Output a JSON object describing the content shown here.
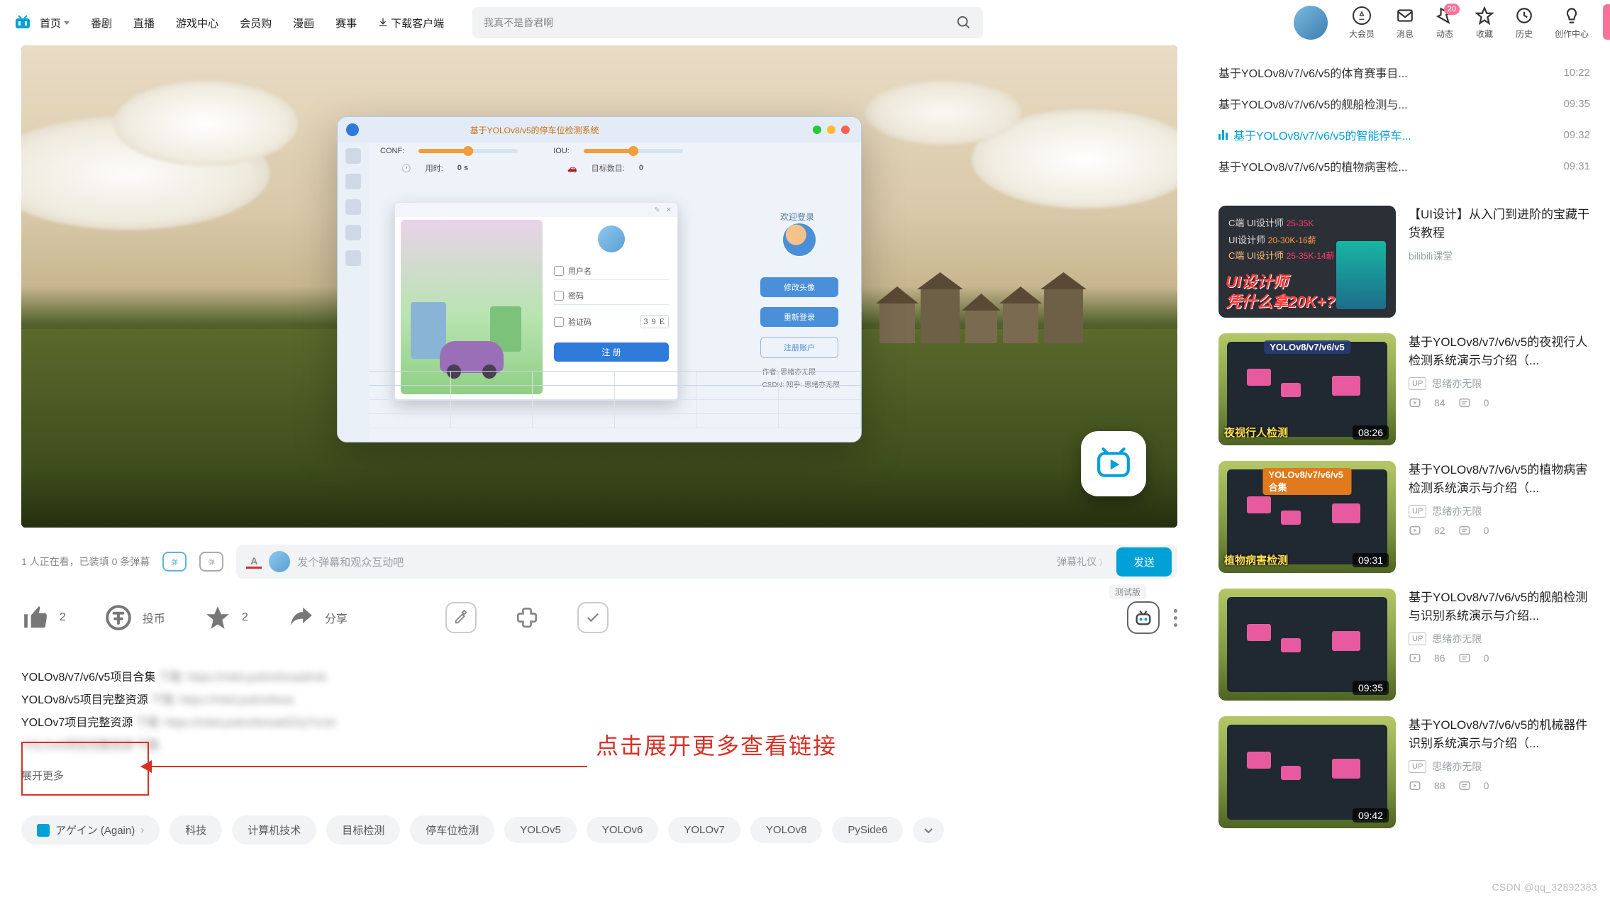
{
  "nav": {
    "items": [
      "首页",
      "番剧",
      "直播",
      "游戏中心",
      "会员购",
      "漫画",
      "赛事"
    ],
    "download": "下载客户端"
  },
  "search": {
    "placeholder": "我真不是昏君啊"
  },
  "usernav": {
    "items": [
      {
        "label": "大会员"
      },
      {
        "label": "消息"
      },
      {
        "label": "动态",
        "badge": "20"
      },
      {
        "label": "收藏"
      },
      {
        "label": "历史"
      },
      {
        "label": "创作中心"
      }
    ]
  },
  "win": {
    "title": "基于YOLOv8/v5的停车位检测系统",
    "conf": "CONF:",
    "iou": "IOU:",
    "timeLbl": "用时:",
    "timeVal": "0 s",
    "tgtLbl": "目标数目:",
    "tgtVal": "0",
    "rtitle": "欢迎登录",
    "captcha": "3 9 E",
    "form": {
      "user": "用户名",
      "pass": "密码",
      "code": "验证码",
      "reg": "注 册"
    },
    "btns": [
      "修改头像",
      "重新登录",
      "注册账户"
    ],
    "info1": "作者: 思绪亦无限",
    "info2": "CSDN: 知乎: 思绪亦无限"
  },
  "dmk": {
    "viewers": "1 人正在看，已装填 0 条弹幕",
    "placeholder": "发个弹幕和观众互动吧",
    "courtesy": "弹幕礼仪",
    "send": "发送"
  },
  "actions": {
    "like": "2",
    "coin": "投币",
    "fav": "2",
    "share": "分享",
    "ai_label": "测试版"
  },
  "desc": {
    "l1_clear": "YOLOv8/v7/v6/v5项目合集",
    "l1_blur": "下载: https://mbd.pub/o/bread/mb",
    "l2_clear": "YOLOv8/v5项目完整资源",
    "l2_blur": "下载: https://mbd.pub/o/brea",
    "l3_clear": "YOLOv7项目完整资源",
    "l3_blur": "下载: https://mbd.pub/o/bread/ZZyTmJe",
    "l4_clear": "YOLOv6项目完整资源",
    "l4_blur": "下载:",
    "expand": "展开更多",
    "anno": "点击展开更多查看链接"
  },
  "tags": [
    "アゲイン (Again)",
    "科技",
    "计算机技术",
    "目标检测",
    "停车位检测",
    "YOLOv5",
    "YOLOv6",
    "YOLOv7",
    "YOLOv8",
    "PySide6"
  ],
  "playlist": [
    {
      "title": "基于YOLOv8/v7/v6/v5的体育赛事目...",
      "time": "10:22",
      "active": false
    },
    {
      "title": "基于YOLOv8/v7/v6/v5的舰船检测与...",
      "time": "09:35",
      "active": false
    },
    {
      "title": "基于YOLOv8/v7/v6/v5的智能停车...",
      "time": "09:32",
      "active": true
    },
    {
      "title": "基于YOLOv8/v7/v6/v5的植物病害检...",
      "time": "09:31",
      "active": false
    }
  ],
  "reco": [
    {
      "kind": "ui1",
      "thumb_lines": [
        "C端 UI设计师",
        "UI设计师",
        "UI设计师",
        "凭什么拿20K+?"
      ],
      "thumb_pink1": "25-35K",
      "thumb_pink2": "25-35K-14薪",
      "thumb_orange": "20-30K-16薪",
      "title": "【UI设计】从入门到进阶的宝藏干货教程",
      "author": "bilibili课堂",
      "dur": "",
      "views": "",
      "dm": "",
      "show_stats": false
    },
    {
      "kind": "grass",
      "yolo": "YOLOv8/v7/v6/v5",
      "caption": "夜视行人检测",
      "title": "基于YOLOv8/v7/v6/v5的夜视行人检测系统演示与介绍（...",
      "author": "思绪亦无限",
      "dur": "08:26",
      "views": "84",
      "dm": "0",
      "show_stats": true
    },
    {
      "kind": "grass",
      "yolo": "YOLOv8/v7/v6/v5合集",
      "caption": "植物病害检测",
      "yolo_style": "orange",
      "title": "基于YOLOv8/v7/v6/v5的植物病害检测系统演示与介绍（...",
      "author": "思绪亦无限",
      "dur": "09:31",
      "views": "82",
      "dm": "0",
      "show_stats": true
    },
    {
      "kind": "grass",
      "yolo": "",
      "caption": "",
      "title": "基于YOLOv8/v7/v6/v5的舰船检测与识别系统演示与介绍...",
      "author": "思绪亦无限",
      "dur": "09:35",
      "views": "86",
      "dm": "0",
      "show_stats": true
    },
    {
      "kind": "grass",
      "yolo": "",
      "caption": "",
      "title": "基于YOLOv8/v7/v6/v5的机械器件识别系统演示与介绍（...",
      "author": "思绪亦无限",
      "dur": "09:42",
      "views": "88",
      "dm": "0",
      "show_stats": true
    }
  ],
  "watermark": "CSDN @qq_32892383"
}
